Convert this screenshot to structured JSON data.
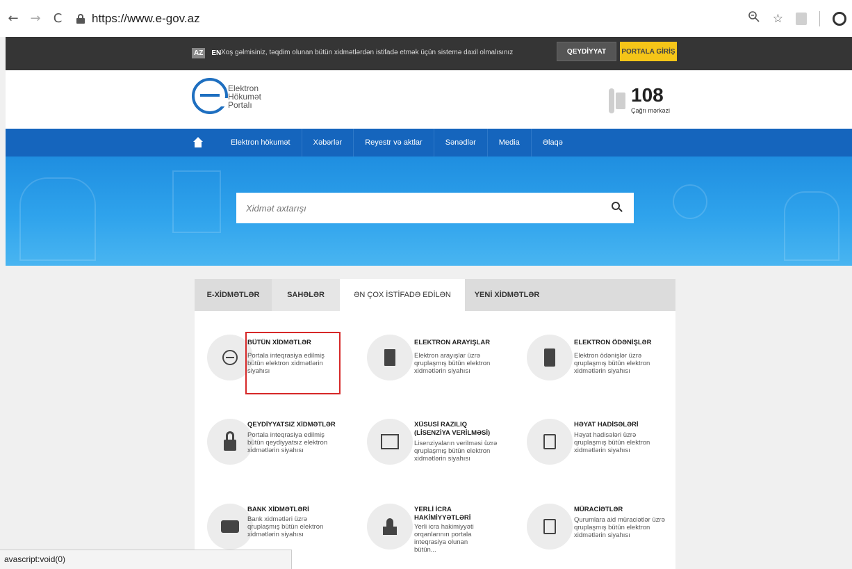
{
  "browser": {
    "back": "←",
    "forward": "→",
    "reload": "C",
    "url": "https://www.e-gov.az",
    "zoom_icon": "zoom-icon",
    "star": "☆"
  },
  "topbar": {
    "lang_active": "AZ",
    "lang_other": "EN",
    "welcome": "Xoş gəlmisiniz, təqdim olunan bütün xidmətlərdən istifadə etmək üçün sistemə daxil olmalısınız",
    "register": "QEYDİYYAT",
    "login": "PORTALA GİRİŞ"
  },
  "header": {
    "logo_line1": "Elektron",
    "logo_line2": "Hökumət",
    "logo_line3": "Portalı",
    "hotline_number": "108",
    "hotline_label": "Çağrı mərkəzi"
  },
  "nav": {
    "items": [
      "Elektron hökumət",
      "Xəbərlər",
      "Reyestr və aktlar",
      "Sənədlər",
      "Media",
      "Əlaqə"
    ]
  },
  "search": {
    "placeholder": "Xidmət axtarışı"
  },
  "tabs": [
    "E-XİDMƏTLƏR",
    "SAHƏLƏR",
    "ƏN ÇOX İSTİFADƏ EDİLƏN",
    "YENİ XİDMƏTLƏR"
  ],
  "cards": [
    {
      "title": "BÜTÜN XİDMƏTLƏR",
      "desc": "Portala inteqrasiya edilmiş bütün elektron xidmətlərin siyahısı",
      "icon": "e-logo-icon"
    },
    {
      "title": "ELEKTRON ARAYIŞLAR",
      "desc": "Elektron arayışlar üzrə qruplaşmış bütün elektron xidmətlərin siyahısı",
      "icon": "document-icon"
    },
    {
      "title": "ELEKTRON ÖDƏNİŞLƏR",
      "desc": "Elektron ödənişlər üzrə qruplaşmış bütün elektron xidmətlərin siyahısı",
      "icon": "pos-terminal-icon"
    },
    {
      "title": "QEYDİYYATSIZ XİDMƏTLƏR",
      "desc": "Portala inteqrasiya edilmiş bütün qeydiyyatsız elektron xidmətlərin siyahısı",
      "icon": "unlock-icon"
    },
    {
      "title": "XÜSUSİ RAZILIQ (LİSENZİYA VERİLMƏSİ)",
      "desc": "Lisenziyaların verilməsi üzrə qruplaşmış bütün elektron xidmətlərin siyahısı",
      "icon": "certificate-icon"
    },
    {
      "title": "HƏYAT HADİSƏLƏRİ",
      "desc": "Həyat hadisələri üzrə qruplaşmış bütün elektron xidmətlərin siyahısı",
      "icon": "note-edit-icon"
    },
    {
      "title": "BANK XİDMƏTLƏRİ",
      "desc": "Bank xidmətləri üzrə qruplaşmış bütün elektron xidmətlərin siyahısı",
      "icon": "bank-card-icon"
    },
    {
      "title": "YERLİ İCRA HAKİMİYYƏTLƏRİ",
      "desc": "Yerli icra hakimiyyəti orqanlarının portala inteqrasiya olunan bütün...",
      "icon": "government-building-icon"
    },
    {
      "title": "MÜRACİƏTLƏR",
      "desc": "Qurumlara aid müraciətlər üzrə qruplaşmış bütün elektron xidmətlərin siyahısı",
      "icon": "note-edit-icon"
    }
  ],
  "statusbar": {
    "text": "avascript:void(0)"
  },
  "colors": {
    "nav_blue": "#1565bd",
    "login_yellow": "#f5c518",
    "highlight_red": "#d62828"
  }
}
